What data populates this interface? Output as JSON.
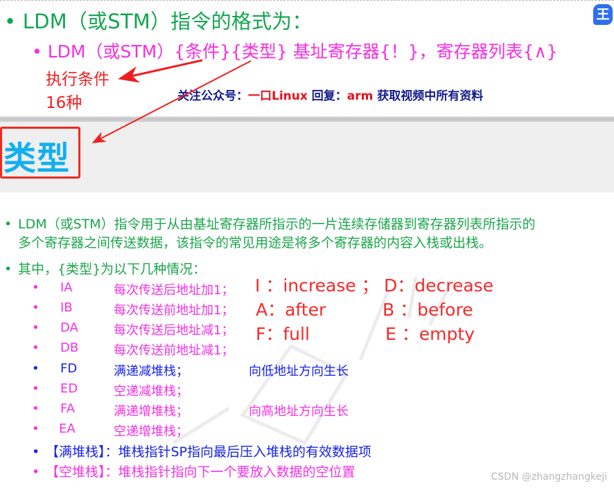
{
  "slide1": {
    "heading_bullet": "•",
    "heading": "LDM（或STM）指令的格式为：",
    "syntax_bullet": "•",
    "syntax": "LDM（或STM）{条件}{类型} 基址寄存器{！}，寄存器列表{∧}",
    "exec_cond_line1": "执行条件",
    "exec_cond_line2": "16种",
    "notice": {
      "part1": "关注公众号：",
      "part2": "一口Linux",
      "part3": "  回复：",
      "part4": "arm",
      "part5": " 获取视频中所有资料"
    },
    "app_icon_glyph": "王"
  },
  "section_title": "类型",
  "slide2": {
    "para1_line1": "LDM（或STM）指令用于从由基址寄存器所指示的一片连续存储器到寄存器列表所指示的",
    "para1_line2": "多个寄存器之间传送数据，该指令的常见用途是将多个寄存器的内容入栈或出栈。",
    "para2": "其中，{类型}为以下几种情况：",
    "bullet": "•",
    "rows": [
      {
        "code": "IA",
        "desc": "每次传送后地址加1；",
        "note": ""
      },
      {
        "code": "IB",
        "desc": "每次传送前地址加1；",
        "note": ""
      },
      {
        "code": "DA",
        "desc": "每次传送后地址减1；",
        "note": ""
      },
      {
        "code": "DB",
        "desc": "每次传送前地址减1；",
        "note": ""
      },
      {
        "code": "FD",
        "desc": "满递减堆栈；",
        "note": "向低地址方向生长"
      },
      {
        "code": "ED",
        "desc": "空递减堆栈；",
        "note": ""
      },
      {
        "code": "FA",
        "desc": "满递增堆栈；",
        "note": "向高地址方向生长"
      },
      {
        "code": "EA",
        "desc": "空递增堆栈；",
        "note": ""
      }
    ],
    "abbreviations": [
      {
        "left": "I ：increase  ；",
        "right": "D：decrease"
      },
      {
        "left": "A：after",
        "right": "B ：before"
      },
      {
        "left": "F：full",
        "right": "E ：empty"
      }
    ],
    "full_stack": "【满堆栈】：堆栈指针SP指向最后压入堆栈的有效数据项",
    "empty_stack": "【空堆栈】：堆栈指针指向下一个要放入数据的空位置"
  },
  "watermark": "CSDN @zhangzhangkeji",
  "colors": {
    "green": "#12a64f",
    "pink": "#f232e6",
    "red": "#f21d1d",
    "blue": "#1623e8",
    "navy": "#121c8c",
    "cyan": "#12aef0"
  }
}
